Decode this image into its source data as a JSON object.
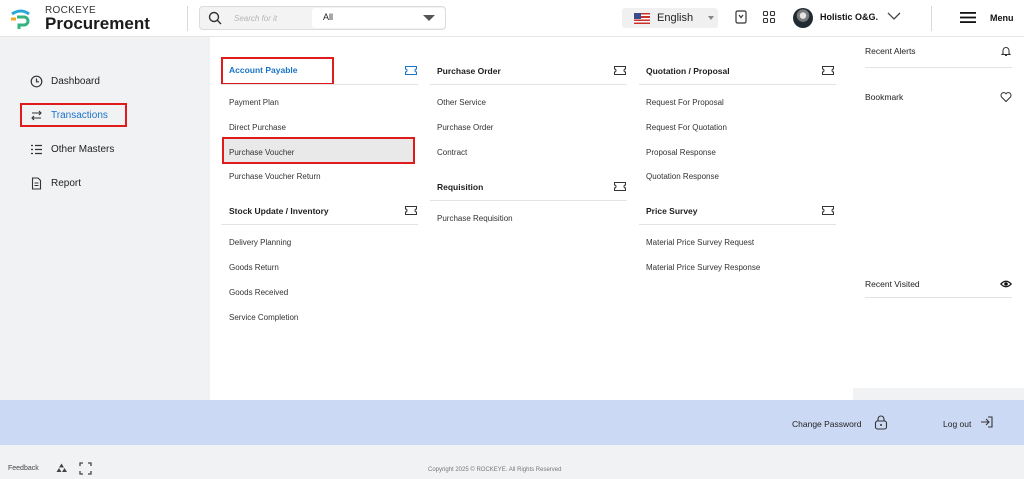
{
  "header": {
    "brand_small": "ROCKEYE",
    "brand_big": "Procurement",
    "search_placeholder": "Search for it",
    "search_scope": "All",
    "language": "English",
    "org_name": "Holistic O&G.",
    "menu_label": "Menu"
  },
  "nav": {
    "items": [
      {
        "label": "Dashboard",
        "icon": "clock-icon"
      },
      {
        "label": "Transactions",
        "icon": "swap-arrows-icon"
      },
      {
        "label": "Other Masters",
        "icon": "list-icon"
      },
      {
        "label": "Report",
        "icon": "document-icon"
      }
    ]
  },
  "mega": {
    "account_payable": {
      "title": "Account Payable",
      "links": [
        "Payment Plan",
        "Direct Purchase",
        "Purchase Voucher",
        "Purchase Voucher Return"
      ]
    },
    "stock_update": {
      "title": "Stock Update / Inventory",
      "links": [
        "Delivery Planning",
        "Goods Return",
        "Goods Received",
        "Service Completion"
      ]
    },
    "purchase_order": {
      "title": "Purchase Order",
      "links": [
        "Other Service",
        "Purchase Order",
        "Contract"
      ]
    },
    "requisition": {
      "title": "Requisition",
      "links": [
        "Purchase Requisition"
      ]
    },
    "quotation": {
      "title": "Quotation / Proposal",
      "links": [
        "Request For Proposal",
        "Request For Quotation",
        "Proposal Response",
        "Quotation Response"
      ]
    },
    "price_survey": {
      "title": "Price Survey",
      "links": [
        "Material Price Survey Request",
        "Material Price Survey Response"
      ]
    }
  },
  "right_panel": {
    "recent_alerts": "Recent Alerts",
    "bookmark": "Bookmark",
    "recent_visited": "Recent Visited"
  },
  "footer_bar": {
    "change_password": "Change Password",
    "logout": "Log out"
  },
  "bottom": {
    "feedback": "Feedback",
    "copyright": "Copyright 2025 © ROCKEYE. All Rights Reserved"
  },
  "colors": {
    "accent": "#1a73c8",
    "highlight_border": "#e01b1b",
    "footer_bar": "#ccd9f5"
  }
}
